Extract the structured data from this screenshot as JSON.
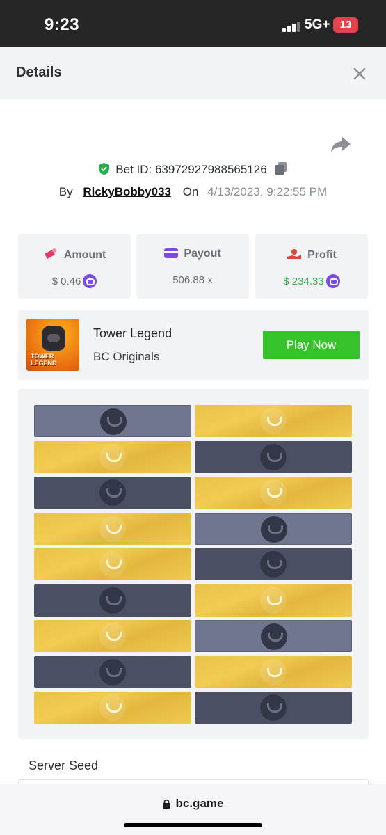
{
  "status_bar": {
    "time": "9:23",
    "network": "5G+",
    "battery": "13"
  },
  "header": {
    "title": "Details"
  },
  "bet": {
    "label": "Bet ID: 63972927988565126",
    "by_label": "By",
    "username": "RickyBobby033",
    "on_label": "On",
    "date": "4/13/2023, 9:22:55 PM"
  },
  "stats": {
    "amount": {
      "label": "Amount",
      "value": "$ 0.46"
    },
    "payout": {
      "label": "Payout",
      "value": "506.88 x"
    },
    "profit": {
      "label": "Profit",
      "value": "$ 234.33"
    }
  },
  "game": {
    "name": "Tower Legend",
    "provider": "BC Originals",
    "play_label": "Play Now",
    "thumb_text": "TOWER LEGEND"
  },
  "tower": {
    "rows": [
      [
        "grey",
        "gold"
      ],
      [
        "gold",
        "dark"
      ],
      [
        "dark",
        "gold"
      ],
      [
        "gold",
        "grey"
      ],
      [
        "gold",
        "dark"
      ],
      [
        "dark",
        "gold"
      ],
      [
        "gold",
        "grey"
      ],
      [
        "dark",
        "gold"
      ],
      [
        "gold",
        "dark"
      ]
    ]
  },
  "server_seed": {
    "label": "Server Seed"
  },
  "browser": {
    "url": "bc.game"
  },
  "colors": {
    "accent_green": "#35c22b",
    "profit_green": "#2fb347",
    "coin_purple": "#7b4ce0",
    "tile_gold": "#e9c24a",
    "tile_dark": "#4b4f63"
  }
}
